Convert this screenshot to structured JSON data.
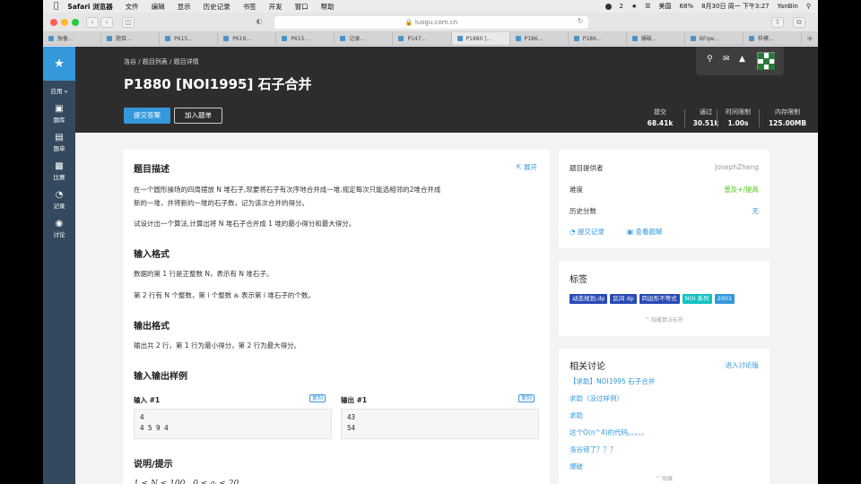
{
  "menubar": {
    "items": [
      "Safari 浏览器",
      "文件",
      "编辑",
      "显示",
      "历史记录",
      "书签",
      "开发",
      "窗口",
      "帮助"
    ],
    "status": {
      "badge": "2",
      "input": "美国",
      "battery": "68%",
      "datetime": "8月30日 周一 下午3:27",
      "user": "YanBin"
    }
  },
  "browser": {
    "url": "luogu.com.cn",
    "tabs": [
      "独备...",
      "题目...",
      "P615...",
      "P619...",
      "P615...",
      "记录...",
      "P147...",
      "P1880 [...",
      "P186...",
      "P186...",
      "爆破...",
      "BFqw...",
      "样模..."
    ],
    "active_tab": 7
  },
  "sidenav": {
    "logo": "luogu-logo",
    "apps": "应用 »",
    "items": [
      {
        "label": "题库",
        "icon": "book-icon"
      },
      {
        "label": "题单",
        "icon": "trash-icon"
      },
      {
        "label": "比赛",
        "icon": "bar-chart-icon"
      },
      {
        "label": "记录",
        "icon": "pie-icon"
      },
      {
        "label": "讨论",
        "icon": "chat-icon"
      }
    ]
  },
  "header": {
    "breadcrumb": "洛谷 / 题目列表 / 题目详情",
    "title": "P1880 [NOI1995] 石子合并",
    "submit": "提交答案",
    "add_to_list": "加入题单",
    "stats": [
      {
        "label": "提交",
        "value": "68.41k"
      },
      {
        "label": "通过",
        "value": "30.51k"
      },
      {
        "label": "时间限制",
        "value": "1.00s"
      },
      {
        "label": "内存限制",
        "value": "125.00MB"
      }
    ]
  },
  "problem": {
    "desc_title": "题目描述",
    "expand": "展开",
    "desc_p1": "在一个圆形操场的四周摆放 N 堆石子,现要将石子有次序地合并成一堆.规定每次只能选相邻的2堆合并成",
    "desc_p1b": "新的一堆，并将新的一堆的石子数，记为该次合并的得分。",
    "desc_p2": "试设计出一个算法,计算出将 N 堆石子合并成 1 堆的最小得分和最大得分。",
    "input_title": "输入格式",
    "input_p1": "数据的第 1 行是正整数 N，表示有 N 堆石子。",
    "input_p2": "第 2 行有 N 个整数，第 i 个整数 aᵢ 表示第 i 堆石子的个数。",
    "output_title": "输出格式",
    "output_p1": "输出共 2 行，第 1 行为最小得分，第 2 行为最大得分。",
    "samples_title": "输入输出样例",
    "input_label": "输入 #1",
    "output_label": "输出 #1",
    "copy": "复制",
    "sample_in": "4\n4 5 9 4",
    "sample_out": "43\n54",
    "hint_title": "说明/提示",
    "hint_p1": "1 ≤ N ≤ 100，0 ≤ aᵢ ≤ 20"
  },
  "info": {
    "provider_label": "题目提供者",
    "provider": "JosephZheng",
    "difficulty_label": "难度",
    "difficulty": "普及+/提高",
    "difficulty_color": "#52c41a",
    "history_label": "历史分数",
    "history": "无",
    "records": "提交记录",
    "solutions": "查看题解"
  },
  "tags": {
    "title": "标签",
    "items": [
      {
        "label": "动态规划,dp",
        "color": "#2949b4"
      },
      {
        "label": "区间 dp",
        "color": "#2949b4"
      },
      {
        "label": "四边形不等式",
        "color": "#2949b4"
      },
      {
        "label": "NOI 系列",
        "color": "#13c2c2"
      },
      {
        "label": "2001",
        "color": "#3498db"
      }
    ],
    "hide": "^ 隐藏算法标签"
  },
  "discuss": {
    "title": "相关讨论",
    "enter": "进入讨论版",
    "items": [
      "【求助】NOI1995 石子合并",
      "求助（没过样例）",
      "求助",
      "这个O(n^4)的代码。。。。。",
      "洛谷错了？？？",
      "爆破"
    ],
    "hide": "^ 隐藏"
  }
}
